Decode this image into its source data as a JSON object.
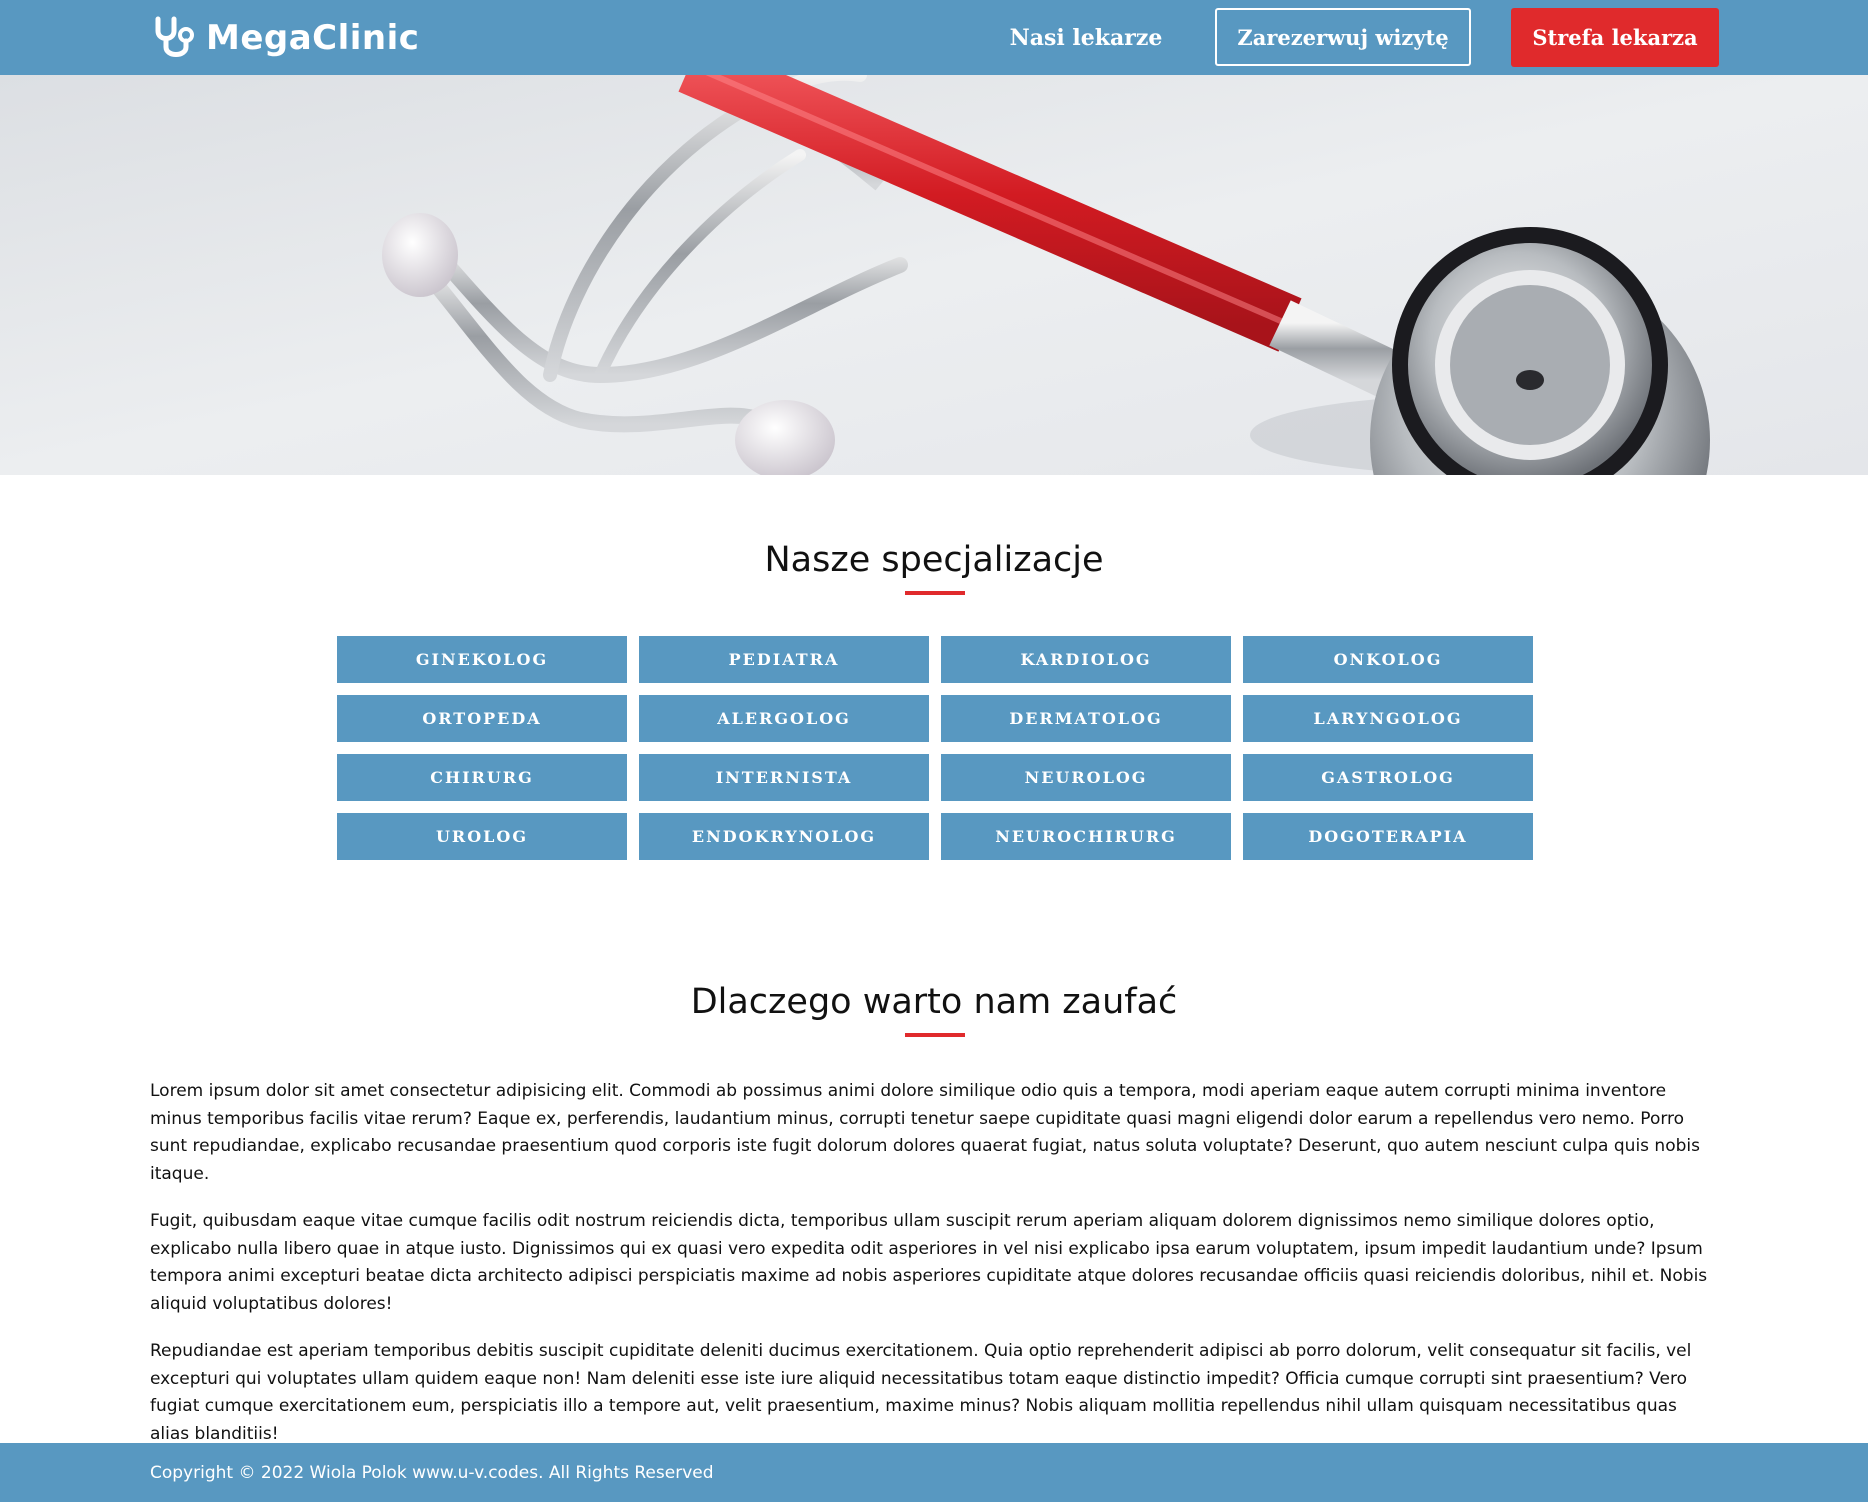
{
  "header": {
    "brand": "MegaClinic",
    "nav_doctors": "Nasi lekarze",
    "nav_book": "Zarezerwuj wizytę",
    "nav_doctor_zone": "Strefa lekarza",
    "logo_icon": "stethoscope-icon"
  },
  "hero": {
    "image": "stethoscope-photo"
  },
  "specializations": {
    "title": "Nasze specjalizacje",
    "items": [
      "GINEKOLOG",
      "PEDIATRA",
      "KARDIOLOG",
      "ONKOLOG",
      "ORTOPEDA",
      "ALERGOLOG",
      "DERMATOLOG",
      "LARYNGOLOG",
      "CHIRURG",
      "INTERNISTA",
      "NEUROLOG",
      "GASTROLOG",
      "UROLOG",
      "ENDOKRYNOLOG",
      "NEUROCHIRURG",
      "DOGOTERAPIA"
    ]
  },
  "about": {
    "title": "Dlaczego warto nam zaufać",
    "paragraphs": [
      "Lorem ipsum dolor sit amet consectetur adipisicing elit. Commodi ab possimus animi dolore similique odio quis a tempora, modi aperiam eaque autem corrupti minima inventore minus temporibus facilis vitae rerum? Eaque ex, perferendis, laudantium minus, corrupti tenetur saepe cupiditate quasi magni eligendi dolor earum a repellendus vero nemo. Porro sunt repudiandae, explicabo recusandae praesentium quod corporis iste fugit dolorum dolores quaerat fugiat, natus soluta voluptate? Deserunt, quo autem nesciunt culpa quis nobis itaque.",
      "Fugit, quibusdam eaque vitae cumque facilis odit nostrum reiciendis dicta, temporibus ullam suscipit rerum aperiam aliquam dolorem dignissimos nemo similique dolores optio, explicabo nulla libero quae in atque iusto. Dignissimos qui ex quasi vero expedita odit asperiores in vel nisi explicabo ipsa earum voluptatem, ipsum impedit laudantium unde? Ipsum tempora animi excepturi beatae dicta architecto adipisci perspiciatis maxime ad nobis asperiores cupiditate atque dolores recusandae officiis quasi reiciendis doloribus, nihil et. Nobis aliquid voluptatibus dolores!",
      "Repudiandae est aperiam temporibus debitis suscipit cupiditate deleniti ducimus exercitationem. Quia optio reprehenderit adipisci ab porro dolorum, velit consequatur sit facilis, vel excepturi qui voluptates ullam quidem eaque non! Nam deleniti esse iste iure aliquid necessitatibus totam eaque distinctio impedit? Officia cumque corrupti sint praesentium? Vero fugiat cumque exercitationem eum, perspiciatis illo a tempore aut, velit praesentium, maxime minus? Nobis aliquam mollitia repellendus nihil ullam quisquam necessitatibus quas alias blanditiis!"
    ]
  },
  "footer": {
    "copyright": "Copyright © 2022 Wiola Polok www.u-v.codes. All Rights Reserved"
  },
  "colors": {
    "primary": "#5898c1",
    "accent": "#e02a2c",
    "text": "#111111",
    "background": "#ffffff"
  }
}
